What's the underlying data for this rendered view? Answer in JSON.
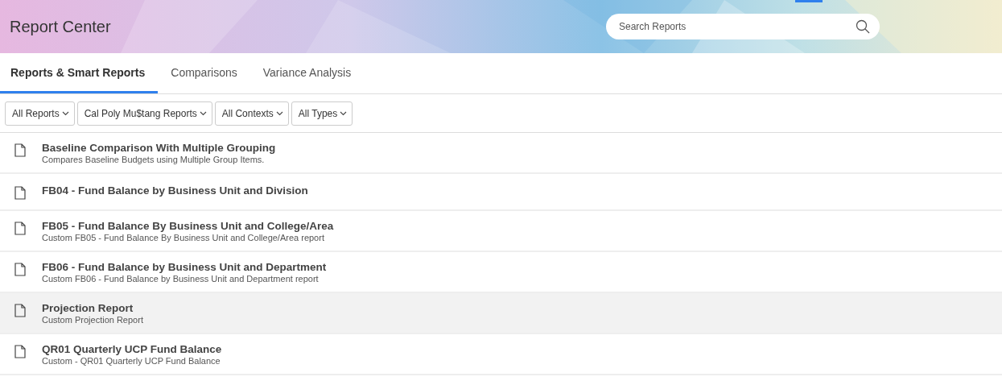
{
  "header": {
    "title": "Report Center",
    "search": {
      "placeholder": "Search Reports"
    }
  },
  "tabs": [
    {
      "label": "Reports & Smart Reports",
      "selected": true
    },
    {
      "label": "Comparisons",
      "selected": false
    },
    {
      "label": "Variance Analysis",
      "selected": false
    }
  ],
  "filters": [
    "All Reports",
    "Cal Poly Mu$tang Reports",
    "All Contexts",
    "All Types"
  ],
  "reports": [
    {
      "title": "Baseline Comparison With Multiple Grouping",
      "description": "Compares Baseline Budgets using Multiple Group Items.",
      "highlighted": false
    },
    {
      "title": "FB04 - Fund Balance by Business Unit and Division",
      "highlighted": false
    },
    {
      "title": "FB05 - Fund Balance By Business Unit and College/Area",
      "description": "Custom FB05 - Fund Balance By Business Unit and College/Area report",
      "highlighted": false
    },
    {
      "title": "FB06 - Fund Balance by Business Unit and Department",
      "description": "Custom FB06 - Fund Balance by Business Unit and Department report",
      "highlighted": false
    },
    {
      "title": "Projection Report",
      "description": "Custom Projection Report",
      "highlighted": true
    },
    {
      "title": "QR01 Quarterly UCP Fund Balance",
      "description": "Custom - QR01 Quarterly UCP Fund Balance",
      "highlighted": false
    }
  ]
}
